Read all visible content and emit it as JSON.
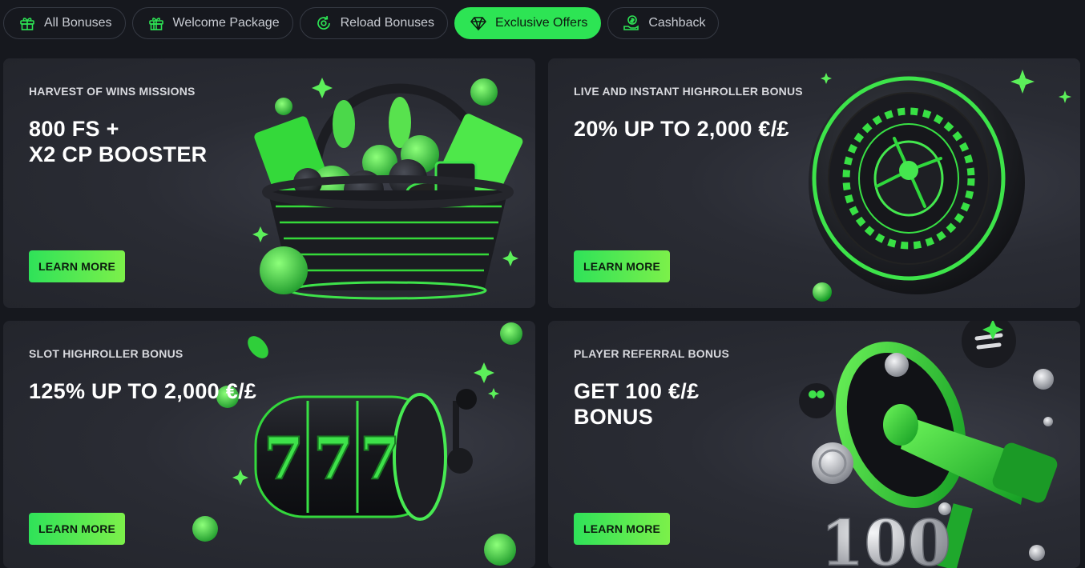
{
  "tabs": [
    {
      "label": "All Bonuses",
      "icon": "gift-icon",
      "active": false
    },
    {
      "label": "Welcome Package",
      "icon": "gift-box-icon",
      "active": false
    },
    {
      "label": "Reload Bonuses",
      "icon": "reload-icon",
      "active": false
    },
    {
      "label": "Exclusive Offers",
      "icon": "diamond-icon",
      "active": true
    },
    {
      "label": "Cashback",
      "icon": "cashback-hand-icon",
      "active": false
    }
  ],
  "cards": [
    {
      "label": "HARVEST OF WINS MISSIONS",
      "headline_1": "800 FS +",
      "headline_2": "X2 CP BOOSTER",
      "button": "LEARN MORE",
      "art": "harvest-basket-illustration"
    },
    {
      "label": "LIVE AND INSTANT HIGHROLLER BONUS",
      "headline_1": "20% UP TO 2,000 €/£",
      "headline_2": "",
      "button": "LEARN MORE",
      "art": "roulette-wheel-illustration"
    },
    {
      "label": "SLOT HIGHROLLER BONUS",
      "headline_1": "125% UP TO 2,000 €/£",
      "headline_2": "",
      "button": "LEARN MORE",
      "art": "slot-reels-illustration"
    },
    {
      "label": "PLAYER REFERRAL BONUS",
      "headline_1": "GET 100 €/£",
      "headline_2": "BONUS",
      "button": "LEARN MORE",
      "art": "megaphone-illustration",
      "art_text": "100"
    }
  ],
  "colors": {
    "accent": "#2de454",
    "background": "#16181e",
    "card": "#2a2c34"
  }
}
